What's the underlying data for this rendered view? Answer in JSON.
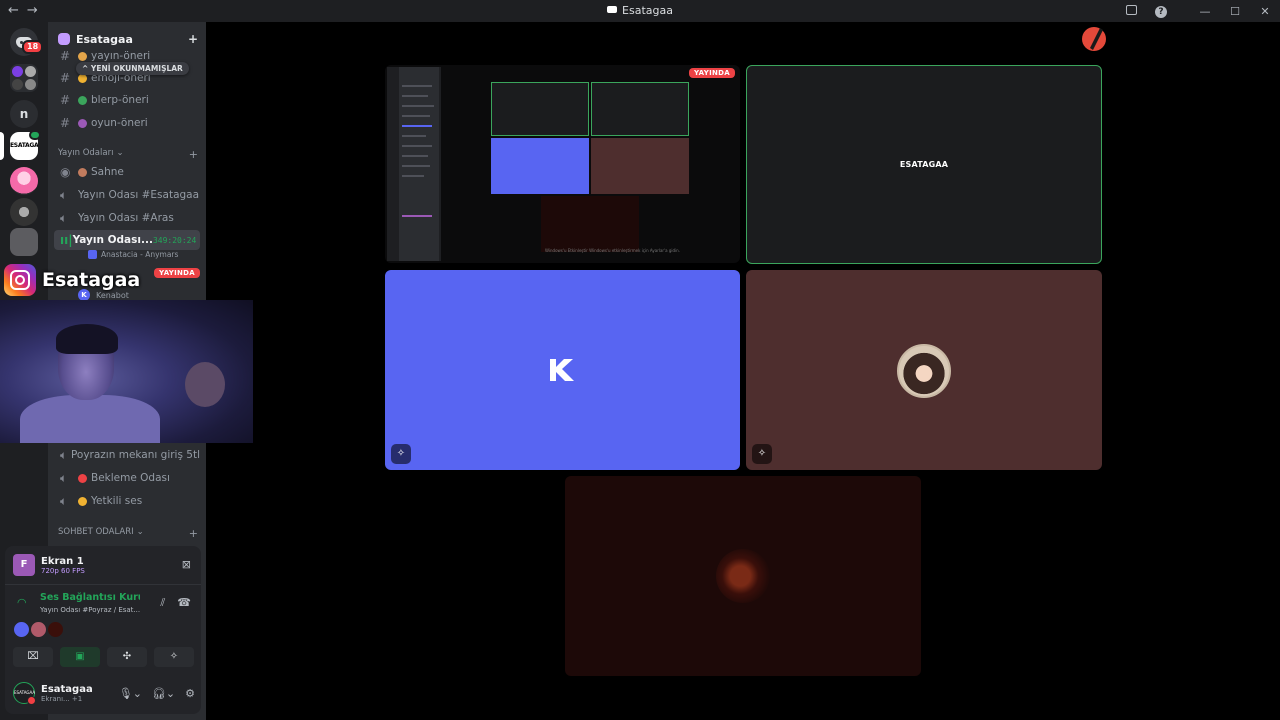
{
  "titlebar": {
    "back": "←",
    "forward": "→",
    "title": "Esatagaa",
    "help": "?",
    "minimize": "—",
    "maximize": "☐",
    "close": "✕"
  },
  "servers": {
    "home_badge": "18",
    "n_label": "n",
    "esa_label": "ESATAGAA"
  },
  "guild": {
    "name": "Esatagaa",
    "invite_icon": "add-member-icon"
  },
  "unread_pill": "^ YENİ OKUNMAMIŞLAR",
  "channels": {
    "text_top": [
      {
        "name": "yayın-öneri",
        "emoji_color": "#e3a54a"
      },
      {
        "name": "emoji-öneri",
        "emoji_color": "#f0b232"
      },
      {
        "name": "blerp-öneri",
        "emoji_color": "#3ba55c"
      },
      {
        "name": "oyun-öneri",
        "emoji_color": "#9b59b6"
      }
    ],
    "category_stream": "Yayın Odaları",
    "stream_rooms": [
      {
        "name": "Sahne",
        "emoji_color": "#c27c5e"
      },
      {
        "name": "Yayın Odası #Esatagaa"
      },
      {
        "name": "Yayın Odası #Aras"
      },
      {
        "name": "Yayın Odası...",
        "timer": "349:20:24",
        "active": true
      }
    ],
    "active_activity": "Anastacia - Anymars",
    "voice_user_kenabot": "Kenabot",
    "voice_bottom": [
      {
        "name": "Poyrazın mekanı giriş 5tl"
      },
      {
        "name": "Bekleme Odası",
        "emoji_color": "#ed4245"
      },
      {
        "name": "Yetkili ses",
        "emoji_color": "#f0b232"
      }
    ],
    "category_chat": "SOHBET ODALARI"
  },
  "overlay": {
    "brand_name": "Esatagaa",
    "live_label": "YAYINDA"
  },
  "user_panel": {
    "stream_title": "Ekran 1",
    "stream_quality": "720p 60 FPS",
    "stream_initial": "F",
    "voice_status": "Ses Bağlantısı Kuruldu",
    "voice_channel": "Yayın Odası #Poyraz / Esat...",
    "buttons": [
      "camera-off-icon",
      "screen-share-icon",
      "activities-icon",
      "soundboard-icon"
    ],
    "username": "Esatagaa",
    "user_status": "Ekranı... +1",
    "avatar_text": "ESATAGAA"
  },
  "stage": {
    "tile_esa_label": "ESATAGAA",
    "screen_live_label": "YAYINDA",
    "screen_tiny_text": "Windows'u Etkinleştir\nWindows'u etkinleştirmek için Ayarlar'a gidin."
  },
  "colors": {
    "accent_blurple": "#5865f2",
    "speaking_green": "#3ba55c",
    "live_red": "#ed4245"
  }
}
